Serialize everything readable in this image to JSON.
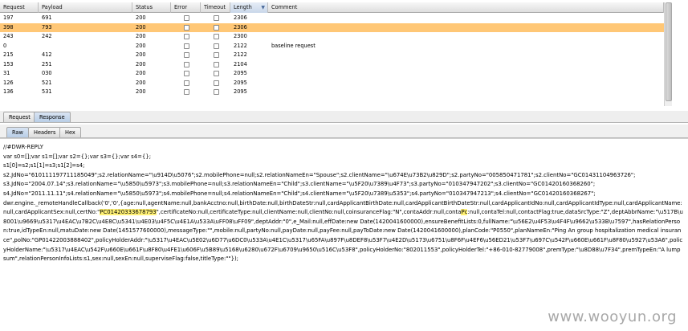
{
  "table": {
    "columns": [
      {
        "label": "Request"
      },
      {
        "label": "Payload"
      },
      {
        "label": "Status"
      },
      {
        "label": "Error"
      },
      {
        "label": "Timeout"
      },
      {
        "label": "Length"
      },
      {
        "label": "Comment"
      }
    ],
    "sorted_column": "Length",
    "rows": [
      {
        "request": "197",
        "payload": "691",
        "status": "200",
        "length": "2306",
        "comment": "",
        "selected": false
      },
      {
        "request": "398",
        "payload": "793",
        "status": "200",
        "length": "2306",
        "comment": "",
        "selected": true
      },
      {
        "request": "243",
        "payload": "242",
        "status": "200",
        "length": "2300",
        "comment": "",
        "selected": false
      },
      {
        "request": "0",
        "payload": "",
        "status": "200",
        "length": "2122",
        "comment": "baseline request",
        "selected": false
      },
      {
        "request": "215",
        "payload": "412",
        "status": "200",
        "length": "2122",
        "comment": "",
        "selected": false
      },
      {
        "request": "153",
        "payload": "251",
        "status": "200",
        "length": "2104",
        "comment": "",
        "selected": false
      },
      {
        "request": "31",
        "payload": "030",
        "status": "200",
        "length": "2095",
        "comment": "",
        "selected": false
      },
      {
        "request": "126",
        "payload": "521",
        "status": "200",
        "length": "2095",
        "comment": "",
        "selected": false
      },
      {
        "request": "136",
        "payload": "531",
        "status": "200",
        "length": "2095",
        "comment": "",
        "selected": false
      },
      {
        "request": "",
        "payload": "",
        "status": "",
        "length": "",
        "comment": "",
        "selected": false
      }
    ],
    "colors": {
      "selected_row": "#ffc776",
      "highlight": "#fff176"
    }
  },
  "tabs": {
    "main": [
      {
        "label": "Request",
        "active": false
      },
      {
        "label": "Response",
        "active": true
      }
    ],
    "view": [
      {
        "label": "Raw",
        "active": true
      },
      {
        "label": "Headers",
        "active": false
      },
      {
        "label": "Hex",
        "active": false
      }
    ]
  },
  "response": {
    "lines": [
      "//#DWR-REPLY",
      "var s0=[];var s1=[];var s2={};var s3={};var s4={};",
      "s1[0]=s2;s1[1]=s3;s1[2]=s4;",
      "s2.JdNo=\"610111197711185049\";s2.relationName=\"\\u914D\\u5076\";s2.mobilePhone=null;s2.relationNameEn=\"Spouse\";s2.clientName=\"\\u674E\\u73B2\\u829D\";s2.partyNo=\"005850471781\";s2.clientNo=\"GC01431104963726\";",
      "s3.JdNo=\"2004.07.14\";s3.relationName=\"\\u5850\\u5973\";s3.mobilePhone=null;s3.relationNameEn=\"Child\";s3.clientName=\"\\u5F20\\u7389\\u4F73\";s3.partyNo=\"010347947202\";s3.clientNo=\"GC01420160368260\";",
      "s4.JdNo=\"2011.11.11\";s4.relationName=\"\\u5850\\u5973\";s4.mobilePhone=null;s4.relationNameEn=\"Child\";s4.clientName=\"\\u5F20\\u7389\\u5353\";s4.partyNo=\"010347947213\";s4.clientNo=\"GC01420160368267\";",
      "dwr.engine._remoteHandleCallback('0','0',{age:null,agentName:null,bankAcctno:null,birthDate:null,birthDateStr:null,cardApplicantBirthDate:null,cardApplicantBirthDateStr:null,cardApplicantIdNo:null,cardApplicantIdType:null,cardApplicantName:null,cardApplicantSex:null,certNo:\"",
      "PC01420333678793",
      "\",certificateNo:null,certificateType:null,clientName:null,clientNo:null,coinsuranceFlag:\"N\",contaAddr:null,conta",
      "Pc",
      ":null,contaTel:null,contactFlag:true,dataSrcType:\"Z\",deptAbbrName:\"\\u517B\\u8001\\u9669\\u5317\\u4EAC\\u7B2C\\u4E8C\\u5341\\u4E03\\u4F5C\\u4E1A\\u533A\\uFF08\\uFF09\",deptAddr:\"0\",e_Mail:null,effDate:new Date(1420041600000),ensureBenefitLists:0,fullName:\"\\u56E2\\u4F53\\u4F4F\\u9662\\u533B\\u7597\",hasRelationPerson:true,idTypeEn:null,matuDate:new Date(1451577600000),messageType:\"\",mobile:null,partyNo:null,payDate:null,payFee:null,payToDate:new Date(1420041600000),planCode:\"P0550\",planNameEn:\"Ping An group hospitalization medical insurance\",polNo:\"GP01422003888402\",policyHolderAddr:\"\\u5317\\u4EAC\\u5E02\\u6D77\\u6DC0\\u533A\\u4E1C\\u5317\\u65FA\\u897F\\u8DEF8\\u53F7\\u4E2D\\u5173\\u6751\\u8F6F\\u4EF6\\u56ED21\\u53F7\\u697C\\u542F\\u660E\\u661F\\u8F80\\u5927\\u53A6\",policyHolderName:\"\\u5317\\u4EAC\\u542F\\u660E\\u661F\\u8F80\\u4FE1\\u606F\\u5B89\\u5168\\u6280\\u672F\\u6709\\u9650\\u516C\\u53F8\",policyHolderNo:\"802011553\",policyHolderTel:\"+86-010-82779008\",premType:\"\\u8D88\\u7F34\",premTypeEn:\"A lump sum\",relationPersonInfoLists:s1,sex:null,sexEn:null,superviseFlag:false,titleType:\"\"});"
    ]
  },
  "watermark": "www.wooyun.org"
}
